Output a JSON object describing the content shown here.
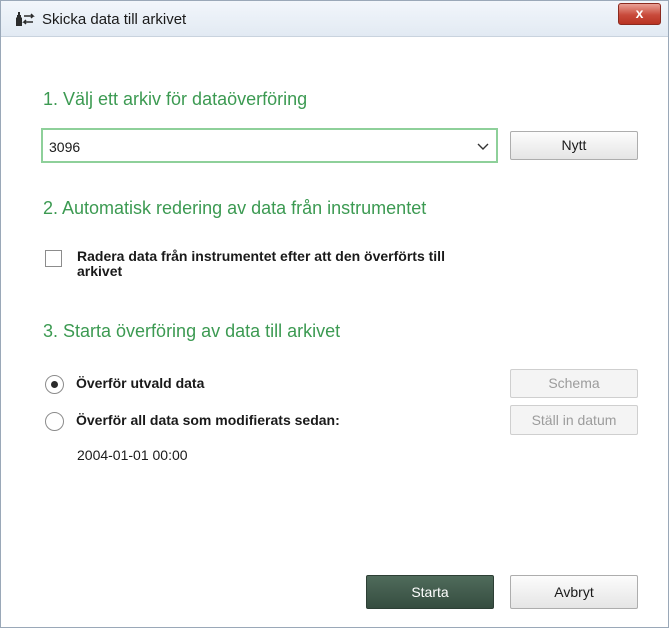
{
  "window": {
    "title": "Skicka data till arkivet",
    "close_label": "x",
    "app_icon": "archive-transfer-icon"
  },
  "section1": {
    "heading": "1. Välj ett arkiv för dataöverföring",
    "archive_select": {
      "value": "3096"
    },
    "new_button": "Nytt"
  },
  "section2": {
    "heading": "2. Automatisk redering av data från instrumentet",
    "delete_checkbox": {
      "checked": false,
      "label": "Radera data från instrumentet efter att den överförts till arkivet"
    }
  },
  "section3": {
    "heading": "3. Starta överföring av data till arkivet",
    "option_selected": {
      "label": "Överför utvald data",
      "selected": true
    },
    "option_modified": {
      "label": "Överför all data som modifierats sedan:",
      "selected": false
    },
    "schedule_button": "Schema",
    "set_date_button": "Ställ in datum",
    "date_value": "2004-01-01 00:00"
  },
  "footer": {
    "start_button": "Starta",
    "cancel_button": "Avbryt"
  }
}
